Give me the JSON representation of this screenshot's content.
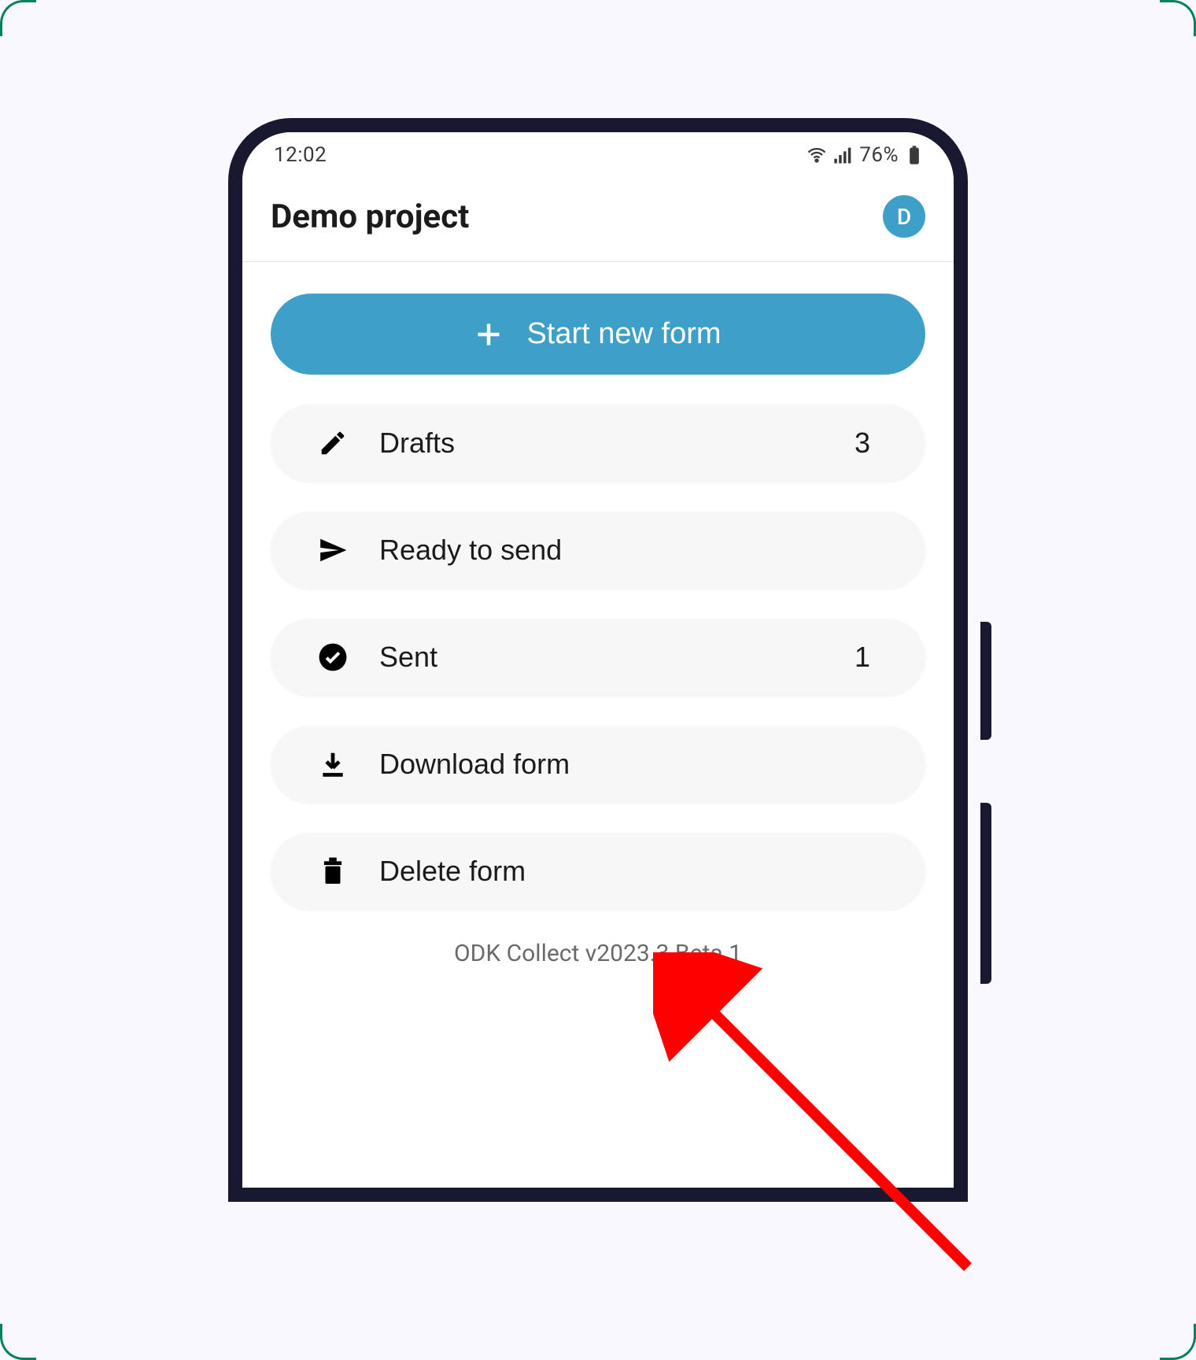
{
  "status": {
    "time": "12:02",
    "battery": "76%"
  },
  "header": {
    "project": "Demo project",
    "avatar_initial": "D"
  },
  "actions": {
    "start_new_form": "Start new form",
    "drafts_label": "Drafts",
    "drafts_count": "3",
    "ready_label": "Ready to send",
    "sent_label": "Sent",
    "sent_count": "1",
    "download_label": "Download form",
    "delete_label": "Delete form"
  },
  "version": "ODK Collect v2023.3 Beta 1",
  "colors": {
    "accent": "#3e9fc8",
    "annotation": "#ff0000"
  }
}
